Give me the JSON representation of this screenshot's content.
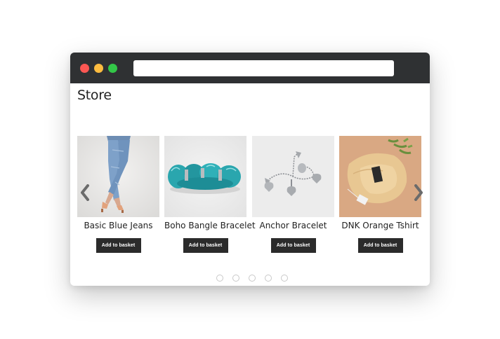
{
  "browser": {
    "url": "",
    "traffic_lights": [
      "close",
      "minimize",
      "maximize"
    ],
    "colors": {
      "titlebar": "#2f3133",
      "close": "#fc5753",
      "minimize": "#fdbc40",
      "maximize": "#33c748"
    }
  },
  "page": {
    "title": "Store"
  },
  "carousel": {
    "prev_icon": "chevron-left-icon",
    "next_icon": "chevron-right-icon",
    "pagination_count": 5,
    "products": [
      {
        "name": "Basic Blue Jeans",
        "button": "Add to basket",
        "image": "jeans-image"
      },
      {
        "name": "Boho Bangle Bracelet",
        "button": "Add to basket",
        "image": "turquoise-bracelet-image"
      },
      {
        "name": "Anchor Bracelet",
        "button": "Add to basket",
        "image": "silver-charm-bracelet-image"
      },
      {
        "name": "DNK Orange Tshirt",
        "button": "Add to basket",
        "image": "folded-tshirt-image"
      }
    ]
  }
}
